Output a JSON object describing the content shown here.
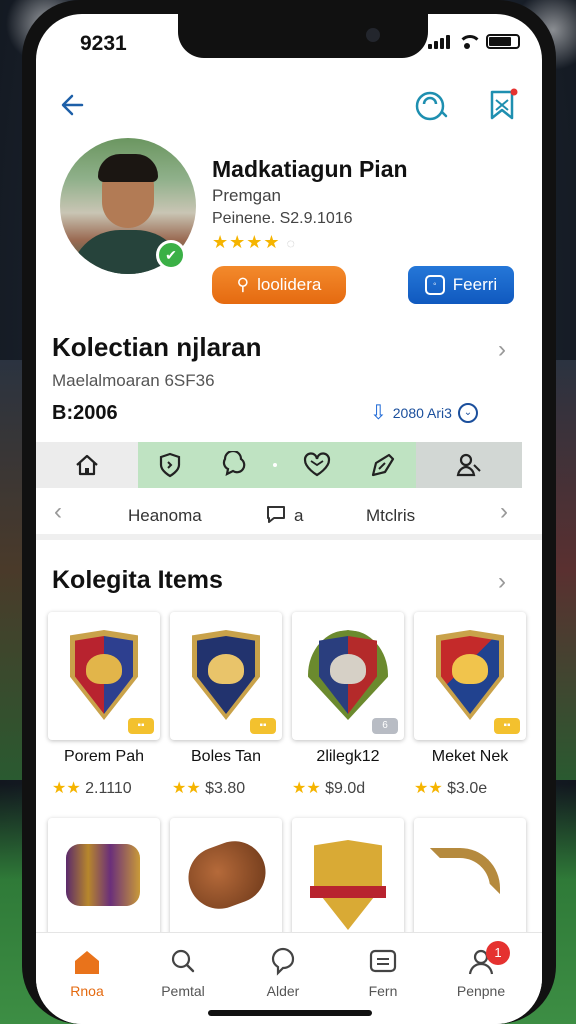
{
  "status": {
    "time": "9231"
  },
  "profile": {
    "name": "Madkatiagun Pian",
    "subtitle": "Premgan",
    "meta": "Peinene. S2.9.1016",
    "rating_stars": 3,
    "rating_max": 4,
    "primary_button": "loolidera",
    "secondary_button": "Feerri"
  },
  "collection": {
    "title": "Kolectian njlaran",
    "subtitle": "Maelalmoaran 6SF36",
    "value": "B:2006",
    "stat": "2080 Ari3"
  },
  "subnav": {
    "left": "Heanoma",
    "middle": "a",
    "right": "Mtclris"
  },
  "items_section": {
    "title": "Kolegita Items",
    "cards": [
      {
        "name": "Porem Pah",
        "price": "2.1110",
        "badge": ""
      },
      {
        "name": "Boles Tan",
        "price": "$3.80",
        "badge": ""
      },
      {
        "name": "2lilegk12",
        "price": "$9.0d",
        "badge": "6"
      },
      {
        "name": "Meket Nek",
        "price": "$3.0e",
        "badge": ""
      }
    ]
  },
  "bottom_nav": [
    {
      "label": "Rnoa",
      "icon": "home-icon",
      "active": true
    },
    {
      "label": "Pemtal",
      "icon": "search-icon"
    },
    {
      "label": "Alder",
      "icon": "chat-icon"
    },
    {
      "label": "Fern",
      "icon": "message-icon"
    },
    {
      "label": "Penpne",
      "icon": "profile-icon",
      "badge": "1"
    }
  ],
  "colors": {
    "accent_orange": "#e56a10",
    "accent_blue": "#1059bf",
    "strip_green": "#bfe3c2",
    "star": "#f5b400"
  }
}
